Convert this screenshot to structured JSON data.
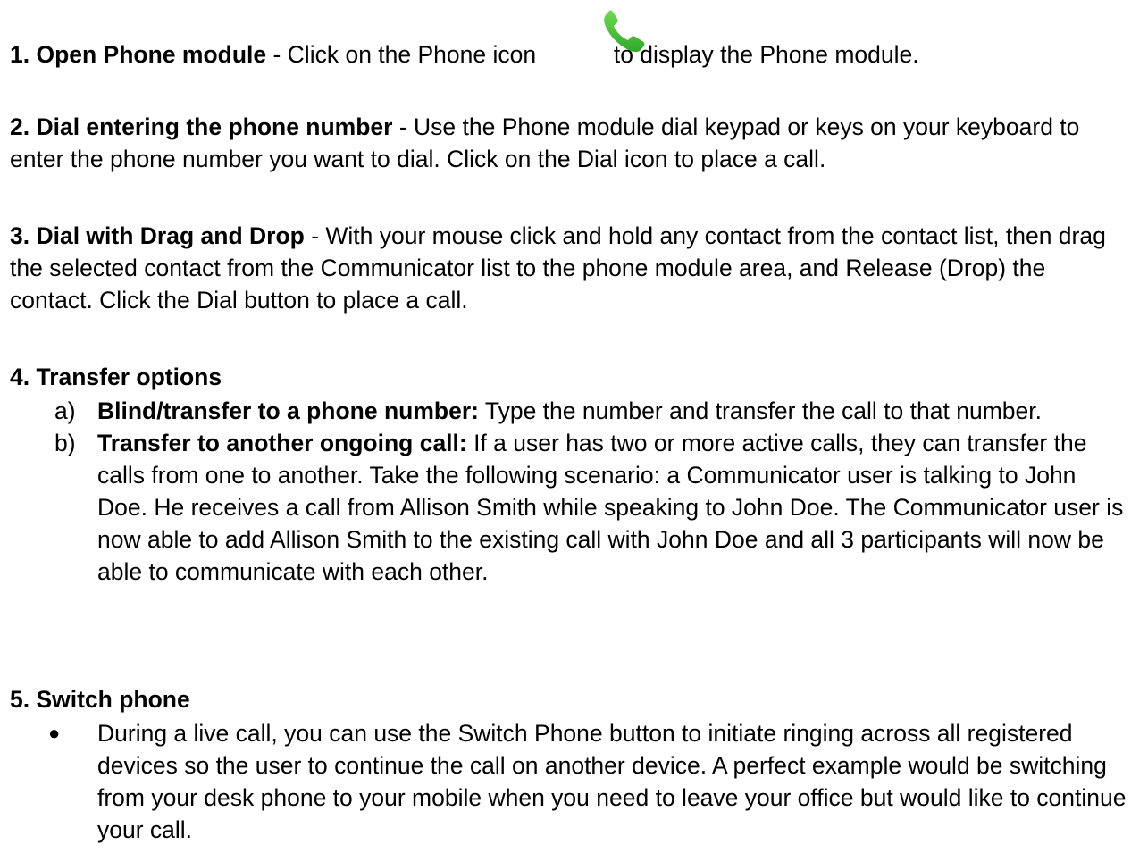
{
  "sections": [
    {
      "heading": "1. Open Phone module",
      "text_before_icon": " - Click on the Phone icon ",
      "text_after_icon": " to display the Phone module."
    },
    {
      "heading": "2. Dial entering the phone number",
      "text": " - Use the Phone module dial keypad or keys on your keyboard to enter the phone number you want to dial. Click on the Dial icon to place a call."
    },
    {
      "heading": "3. Dial with Drag and Drop",
      "text": " - With your mouse click and hold any contact from the contact list, then drag the selected contact from the Communicator list to the phone module area, and Release (Drop) the contact. Click the Dial button to place a call."
    },
    {
      "heading": "4. Transfer options",
      "items": [
        {
          "marker": "a)",
          "title": "Blind/transfer to a phone number:",
          "text": " Type the number and transfer the call to that number."
        },
        {
          "marker": "b)",
          "title": "Transfer to another ongoing call:",
          "text": " If a user has two or more active calls, they can transfer the calls from one to another. Take the following scenario: a Communicator user is talking to John Doe. He receives a call from Allison Smith while speaking to John Doe. The Communicator user is now able to add Allison Smith to the existing call with John Doe and all 3 participants will now be able to communicate with each other."
        }
      ]
    },
    {
      "heading": "5. Switch phone",
      "items": [
        {
          "marker": "●",
          "text": "During a live call, you can use the Switch Phone button to initiate ringing across all registered devices so the user to continue the call on another device. A perfect example would be switching from your desk phone to your mobile when you need to leave your office but would like to continue your call."
        }
      ]
    }
  ],
  "colors": {
    "phone_icon_green": "#4cc93a",
    "text": "#000000"
  },
  "icons": {
    "phone": "phone-handset-icon"
  }
}
